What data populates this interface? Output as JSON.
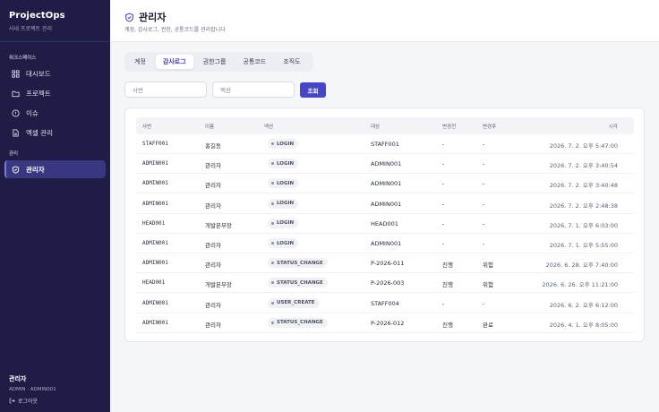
{
  "sidebar": {
    "brand": "ProjectOps",
    "brand_sub": "사내 프로젝트 관리",
    "section_workspace": "워크스페이스",
    "section_admin": "관리",
    "items": [
      {
        "label": "대시보드",
        "icon": "grid-icon"
      },
      {
        "label": "프로젝트",
        "icon": "folder-icon"
      },
      {
        "label": "이슈",
        "icon": "alert-circle-icon"
      },
      {
        "label": "엑셀 관리",
        "icon": "file-icon"
      },
      {
        "label": "관리자",
        "icon": "shield-icon"
      }
    ],
    "user_name": "관리자",
    "user_role": "ADMIN · ADMIN001",
    "logout": "로그아웃"
  },
  "header": {
    "title": "관리자",
    "subtitle": "계정, 감사로그, 권한, 공통코드를 관리합니다"
  },
  "tabs": [
    "계정",
    "감사로그",
    "권한그룹",
    "공통코드",
    "조직도"
  ],
  "active_tab": 1,
  "filters": {
    "emp_placeholder": "사번",
    "action_placeholder": "액션",
    "search_label": "조회"
  },
  "table": {
    "columns": [
      "사번",
      "이름",
      "액션",
      "대상",
      "변경전",
      "변경후",
      "시각"
    ],
    "rows": [
      [
        "STAFF001",
        "홍길동",
        "LOGIN",
        "STAFF001",
        "-",
        "-",
        "2026. 7. 2. 오후 5:47:00"
      ],
      [
        "ADMIN001",
        "관리자",
        "LOGIN",
        "ADMIN001",
        "-",
        "-",
        "2026. 7. 2. 오후 3:40:54"
      ],
      [
        "ADMIN001",
        "관리자",
        "LOGIN",
        "ADMIN001",
        "-",
        "-",
        "2026. 7. 2. 오후 3:40:48"
      ],
      [
        "ADMIN001",
        "관리자",
        "LOGIN",
        "ADMIN001",
        "-",
        "-",
        "2026. 7. 2. 오후 2:48:38"
      ],
      [
        "HEAD001",
        "개발본부장",
        "LOGIN",
        "HEAD001",
        "-",
        "-",
        "2026. 7. 1. 오후 6:03:00"
      ],
      [
        "ADMIN001",
        "관리자",
        "LOGIN",
        "ADMIN001",
        "-",
        "-",
        "2026. 7. 1. 오후 5:55:00"
      ],
      [
        "ADMIN001",
        "관리자",
        "STATUS_CHANGE",
        "P-2026-011",
        "진행",
        "위험",
        "2026. 6. 28. 오후 7:40:00"
      ],
      [
        "HEAD001",
        "개발본부장",
        "STATUS_CHANGE",
        "P-2026-003",
        "진행",
        "위험",
        "2026. 6. 26. 오후 11:21:00"
      ],
      [
        "ADMIN001",
        "관리자",
        "USER_CREATE",
        "STAFF004",
        "-",
        "-",
        "2026. 6. 2. 오후 6:12:00"
      ],
      [
        "ADMIN001",
        "관리자",
        "STATUS_CHANGE",
        "P-2026-012",
        "진행",
        "완료",
        "2026. 4. 1. 오후 8:05:00"
      ]
    ]
  }
}
